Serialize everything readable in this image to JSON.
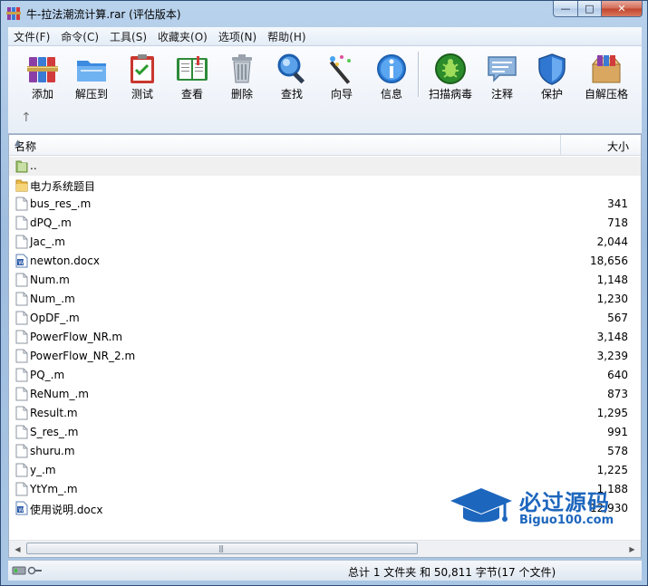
{
  "window": {
    "title": "牛-拉法潮流计算.rar (评估版本)",
    "controls": {
      "minimize": "—",
      "maximize": "□",
      "close": "✕"
    }
  },
  "menubar": [
    {
      "label": "文件(F)"
    },
    {
      "label": "命令(C)"
    },
    {
      "label": "工具(S)"
    },
    {
      "label": "收藏夹(O)"
    },
    {
      "label": "选项(N)"
    },
    {
      "label": "帮助(H)"
    }
  ],
  "toolbar": [
    {
      "label": "添加",
      "icon": "add-books-icon"
    },
    {
      "label": "解压到",
      "icon": "extract-folder-icon"
    },
    {
      "label": "测试",
      "icon": "test-clipboard-icon"
    },
    {
      "label": "查看",
      "icon": "view-book-icon"
    },
    {
      "label": "删除",
      "icon": "trash-icon"
    },
    {
      "label": "查找",
      "icon": "magnifier-icon"
    },
    {
      "label": "向导",
      "icon": "wizard-wand-icon"
    },
    {
      "label": "信息",
      "icon": "info-icon"
    },
    {
      "label": "扫描病毒",
      "icon": "virus-scan-icon"
    },
    {
      "label": "注释",
      "icon": "comment-icon"
    },
    {
      "label": "保护",
      "icon": "shield-icon"
    },
    {
      "label": "自解压格",
      "icon": "sfx-box-icon"
    }
  ],
  "list": {
    "columns": {
      "name": "名称",
      "size": "大小"
    },
    "rows": [
      {
        "name": "..",
        "size": "",
        "type": "parent"
      },
      {
        "name": "电力系统题目",
        "size": "",
        "type": "folder"
      },
      {
        "name": "bus_res_.m",
        "size": "341",
        "type": "file"
      },
      {
        "name": "dPQ_.m",
        "size": "718",
        "type": "file"
      },
      {
        "name": "Jac_.m",
        "size": "2,044",
        "type": "file"
      },
      {
        "name": "newton.docx",
        "size": "18,656",
        "type": "doc"
      },
      {
        "name": "Num.m",
        "size": "1,148",
        "type": "file"
      },
      {
        "name": "Num_.m",
        "size": "1,230",
        "type": "file"
      },
      {
        "name": "OpDF_.m",
        "size": "567",
        "type": "file"
      },
      {
        "name": "PowerFlow_NR.m",
        "size": "3,148",
        "type": "file"
      },
      {
        "name": "PowerFlow_NR_2.m",
        "size": "3,239",
        "type": "file"
      },
      {
        "name": "PQ_.m",
        "size": "640",
        "type": "file"
      },
      {
        "name": "ReNum_.m",
        "size": "873",
        "type": "file"
      },
      {
        "name": "Result.m",
        "size": "1,295",
        "type": "file"
      },
      {
        "name": "S_res_.m",
        "size": "991",
        "type": "file"
      },
      {
        "name": "shuru.m",
        "size": "578",
        "type": "file"
      },
      {
        "name": "y_.m",
        "size": "1,225",
        "type": "file"
      },
      {
        "name": "YtYm_.m",
        "size": "1,188",
        "type": "file"
      },
      {
        "name": "使用说明.docx",
        "size": "12,930",
        "type": "doc"
      }
    ]
  },
  "statusbar": {
    "text": "总计 1 文件夹 和 50,811 字节(17 个文件)"
  },
  "watermark": {
    "text": "必过源码",
    "sub": "Biguo100.com"
  },
  "colors": {
    "accent": "#1d66bd",
    "folder": "#f0c35a",
    "close": "#c1452c"
  }
}
